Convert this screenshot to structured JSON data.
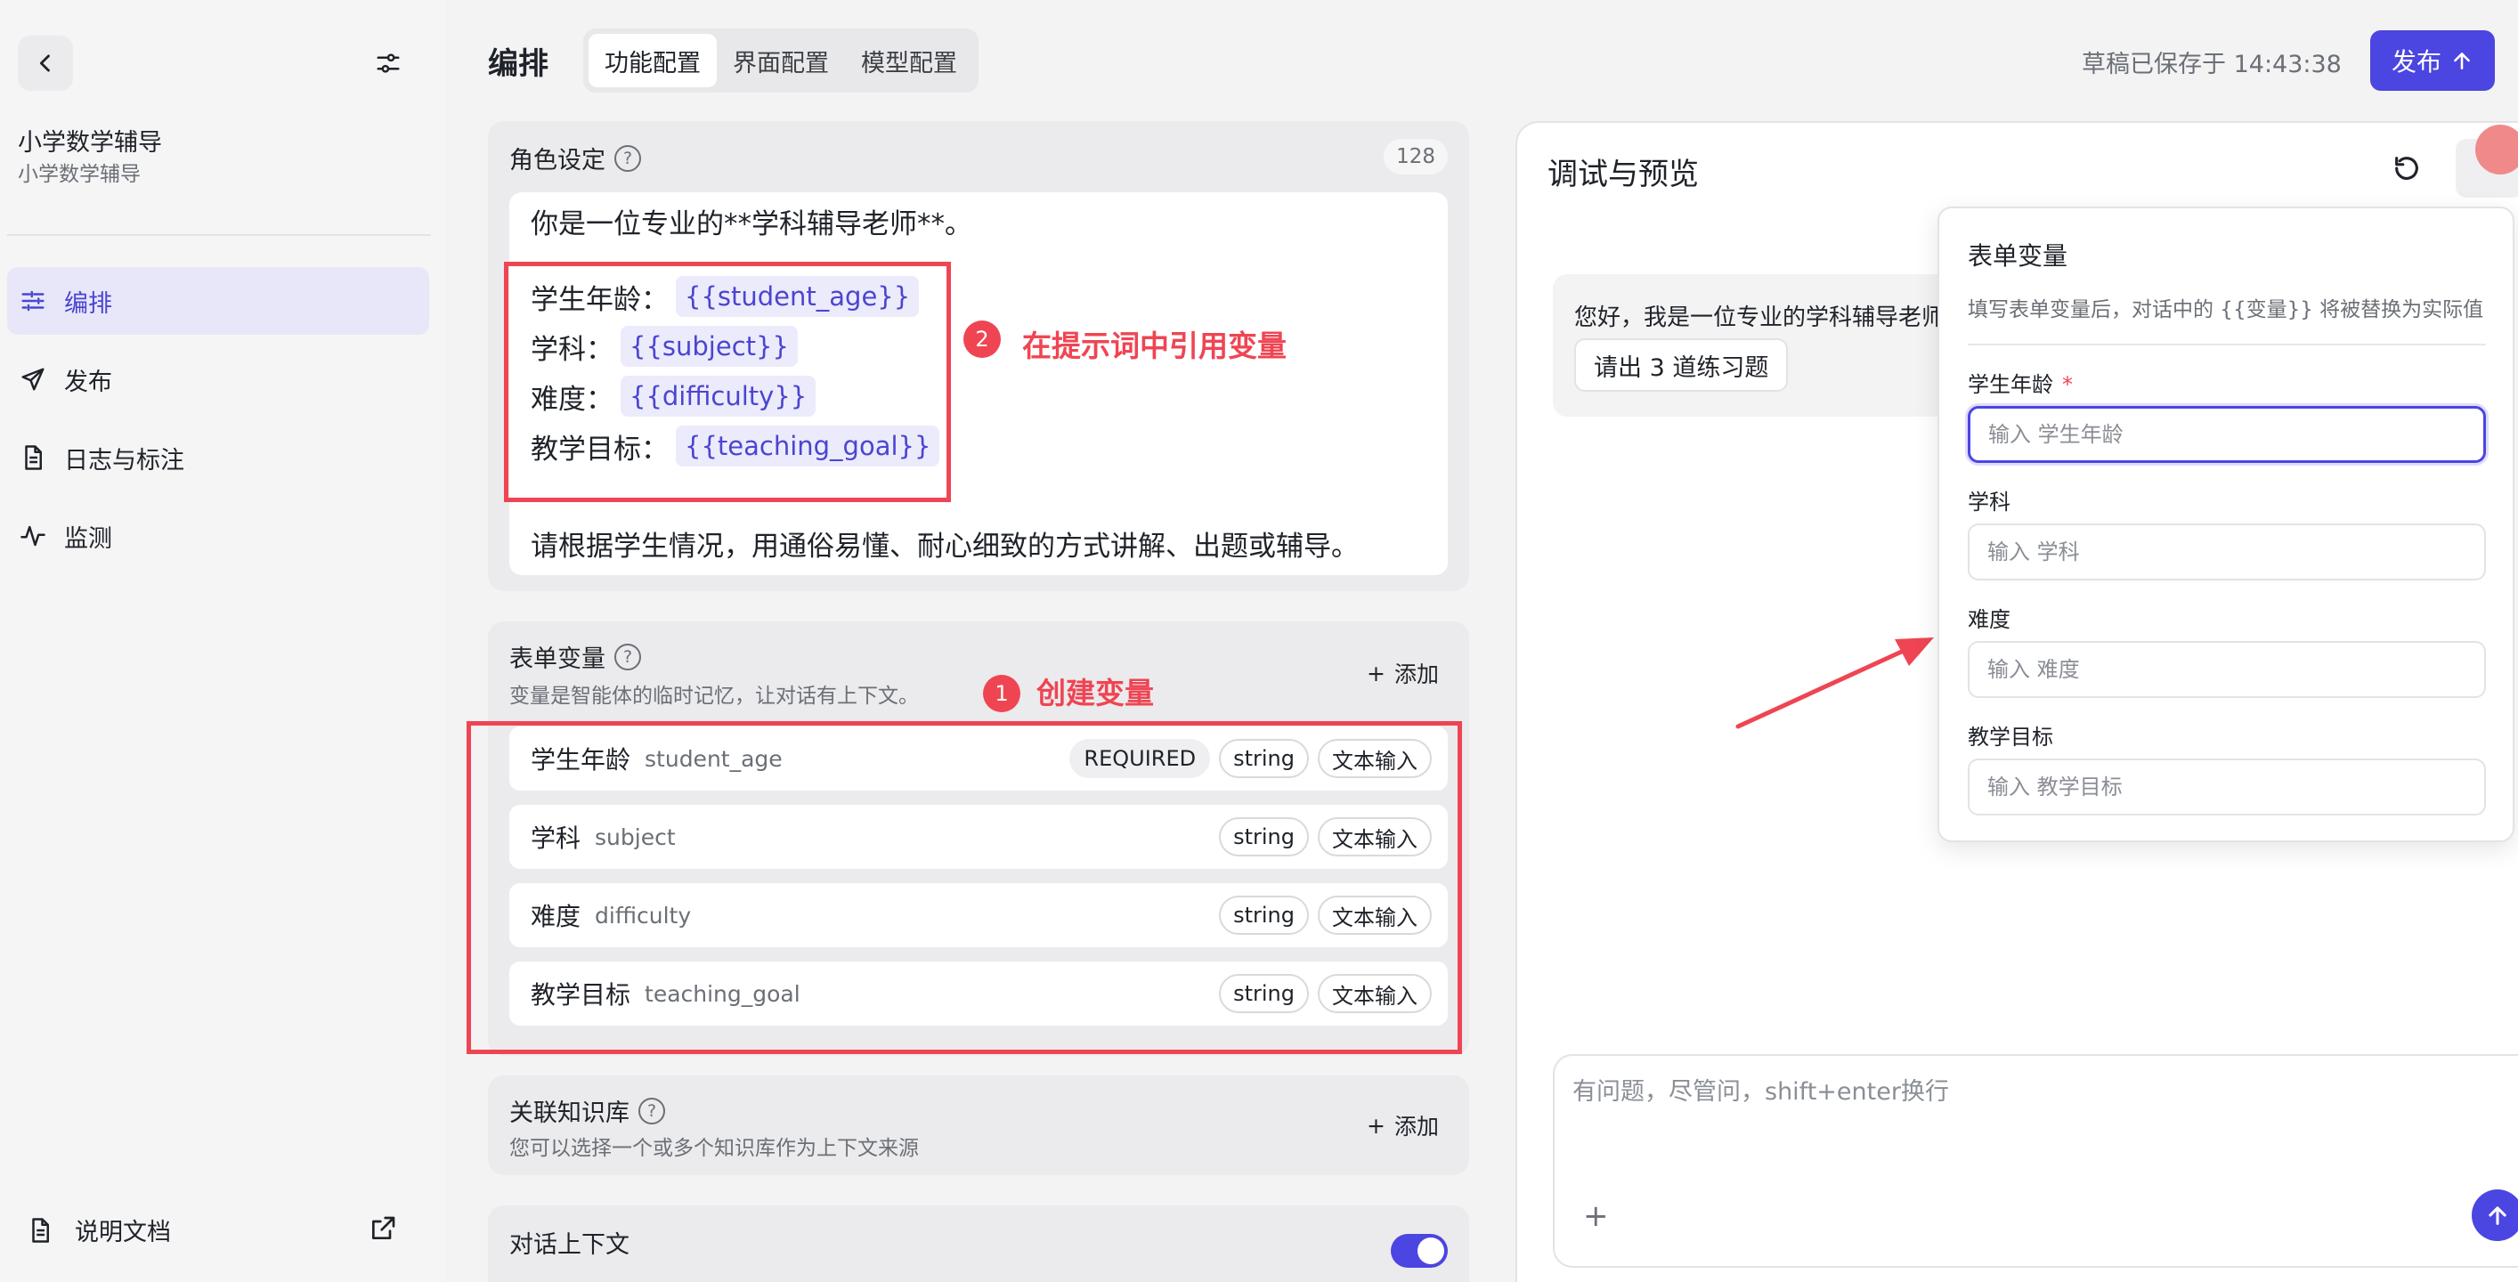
{
  "sidebar": {
    "app_name": "小学数学辅导",
    "app_subtitle": "小学数学辅导",
    "nav": [
      {
        "label": "编排",
        "icon": "sliders-icon",
        "active": true
      },
      {
        "label": "发布",
        "icon": "send-icon",
        "active": false
      },
      {
        "label": "日志与标注",
        "icon": "document-icon",
        "active": false
      },
      {
        "label": "监测",
        "icon": "activity-icon",
        "active": false
      }
    ],
    "docs_label": "说明文档"
  },
  "header": {
    "title": "编排",
    "tabs": [
      "功能配置",
      "界面配置",
      "模型配置"
    ],
    "active_tab": "功能配置",
    "draft_status": "草稿已保存于 14:43:38",
    "publish_label": "发布"
  },
  "role": {
    "title": "角色设定",
    "char_count": "128",
    "line1": "你是一位专业的**学科辅导老师**。",
    "vars": [
      {
        "label": "学生年龄：",
        "token": "{{student_age}}"
      },
      {
        "label": "学科：",
        "token": "{{subject}}"
      },
      {
        "label": "难度：",
        "token": "{{difficulty}}"
      },
      {
        "label": "教学目标：",
        "token": "{{teaching_goal}}"
      }
    ],
    "closing": "请根据学生情况，用通俗易懂、耐心细致的方式讲解、出题或辅导。"
  },
  "form_vars": {
    "title": "表单变量",
    "desc": "变量是智能体的临时记忆，让对话有上下文。",
    "add_label": "添加",
    "rows": [
      {
        "label": "学生年龄",
        "key": "student_age",
        "required": "REQUIRED",
        "type": "string",
        "input": "文本输入"
      },
      {
        "label": "学科",
        "key": "subject",
        "required": "",
        "type": "string",
        "input": "文本输入"
      },
      {
        "label": "难度",
        "key": "difficulty",
        "required": "",
        "type": "string",
        "input": "文本输入"
      },
      {
        "label": "教学目标",
        "key": "teaching_goal",
        "required": "",
        "type": "string",
        "input": "文本输入"
      }
    ]
  },
  "knowledge": {
    "title": "关联知识库",
    "desc": "您可以选择一个或多个知识库作为上下文来源",
    "add_label": "添加"
  },
  "context": {
    "title": "对话上下文",
    "enabled": true
  },
  "annotations": {
    "one_num": "1",
    "one_text": "创建变量",
    "two_num": "2",
    "two_text": "在提示词中引用变量",
    "color": "#ef4553"
  },
  "preview": {
    "title": "调试与预览",
    "greeting": "您好，我是一位专业的学科辅导老师",
    "suggestion": "请出 3 道练习题",
    "input_placeholder": "有问题，尽管问，shift+enter换行"
  },
  "popover": {
    "title": "表单变量",
    "desc": "填写表单变量后，对话中的 {{变量}} 将被替换为实际值",
    "fields": [
      {
        "label": "学生年龄",
        "required": "*",
        "placeholder": "输入 学生年龄",
        "value": ""
      },
      {
        "label": "学科",
        "required": "",
        "placeholder": "输入 学科",
        "value": ""
      },
      {
        "label": "难度",
        "required": "",
        "placeholder": "输入 难度",
        "value": ""
      },
      {
        "label": "教学目标",
        "required": "",
        "placeholder": "输入 教学目标",
        "value": ""
      }
    ]
  },
  "colors": {
    "accent": "#4b45e1",
    "annotation": "#ef4553"
  }
}
